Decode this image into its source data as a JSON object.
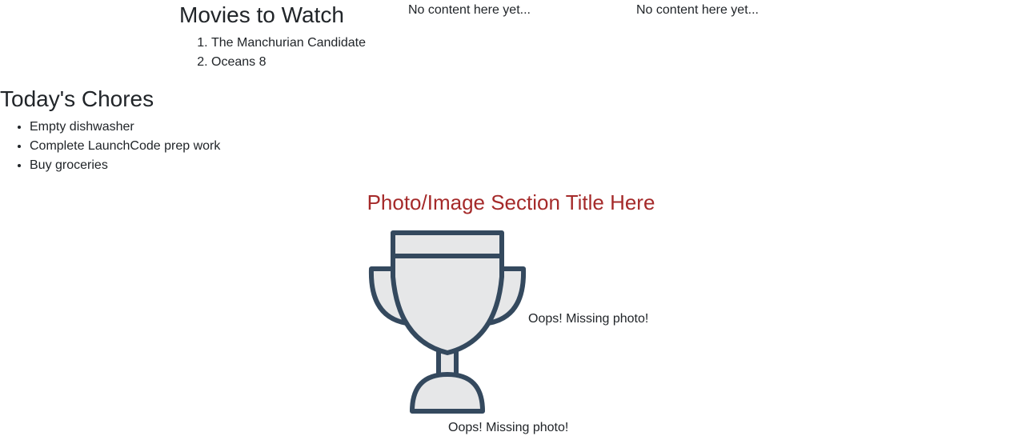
{
  "movies": {
    "title": "Movies to Watch",
    "items": [
      "The Manchurian Candidate",
      "Oceans 8"
    ]
  },
  "placeholders": [
    "No content here yet...",
    "No content here yet..."
  ],
  "chores": {
    "title": "Today's Chores",
    "items": [
      "Empty dishwasher",
      "Complete LaunchCode prep work",
      "Buy groceries"
    ]
  },
  "photo_section": {
    "title": "Photo/Image Section Title Here",
    "title_color": "#a52a2a",
    "image_icon": "trophy-icon",
    "image_alt_inline": "Oops! Missing photo!",
    "image_alt_below": "Oops! Missing photo!"
  },
  "colors": {
    "text": "#212529",
    "trophy_stroke": "#34495e",
    "trophy_fill": "#e6e7e8"
  }
}
